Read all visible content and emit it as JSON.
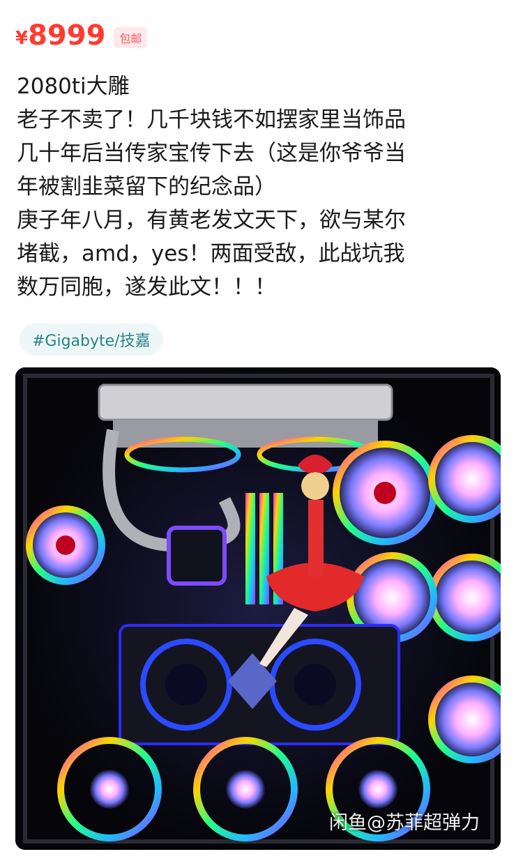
{
  "listing": {
    "currency": "¥",
    "price": "8999",
    "shipping_badge": "包邮",
    "title": "2080ti大雕",
    "description_lines": [
      " 老子不卖了！几千块钱不如摆家里当饰品",
      "几十年后当传家宝传下去（这是你爷爷当",
      "年被割韭菜留下的纪念品）",
      "庚子年八月，有黄老发文天下，欲与某尔",
      "堵截，amd，yes！两面受敌，此战坑我",
      "数万同胞，遂发此文！！！"
    ],
    "tag": "#Gigabyte/技嘉",
    "image_watermark": "闲鱼@苏菲超弹力",
    "photo_description_icon": "pc-case-rgb-photo"
  },
  "colors": {
    "price": "#ff3b30",
    "badge_bg": "#ffe9ea",
    "tag_text": "#27838a",
    "tag_bg": "#eef7f7"
  }
}
